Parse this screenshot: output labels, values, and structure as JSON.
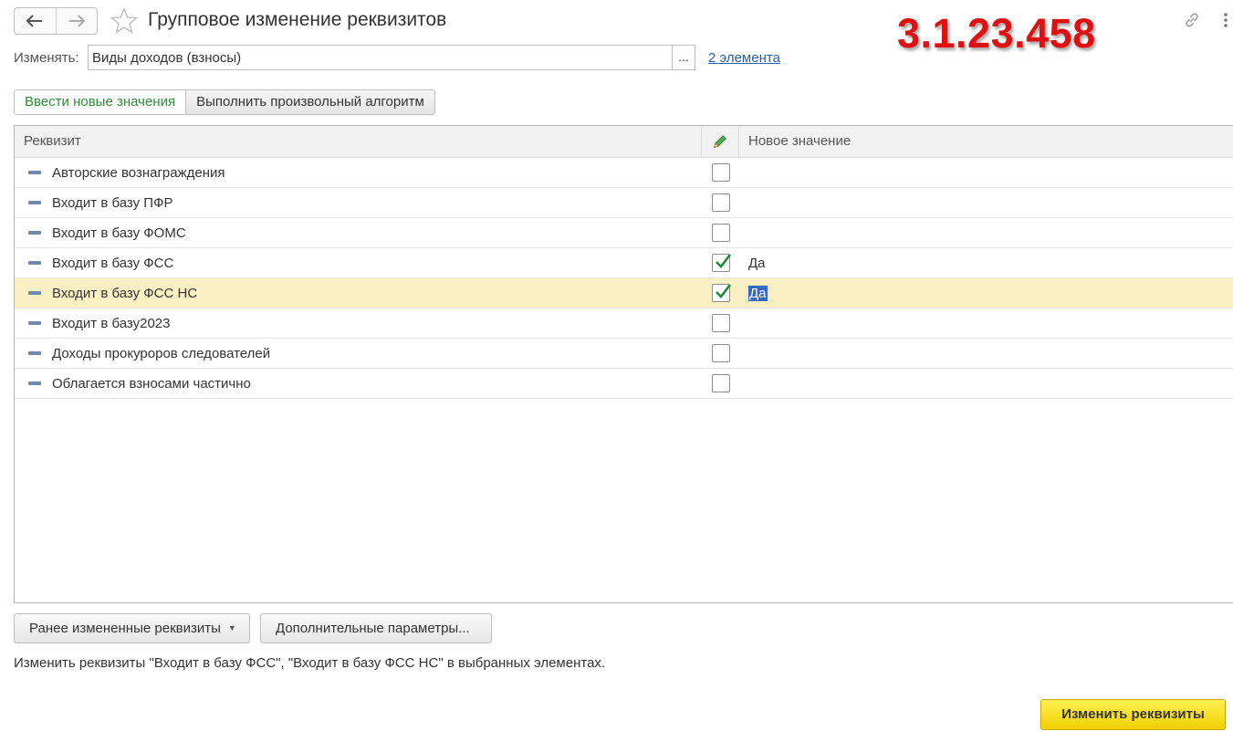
{
  "header": {
    "title": "Групповое изменение реквизитов",
    "version": "3.1.23.458"
  },
  "change": {
    "label": "Изменять:",
    "value": "Виды доходов (взносы)",
    "pick_label": "...",
    "elements_link": "2 элемента"
  },
  "tabs": [
    {
      "label": "Ввести новые значения",
      "active": true
    },
    {
      "label": "Выполнить произвольный алгоритм",
      "active": false
    }
  ],
  "table": {
    "columns": {
      "req": "Реквизит",
      "val": "Новое значение"
    },
    "rows": [
      {
        "name": "Авторские вознаграждения",
        "checked": false,
        "value": ""
      },
      {
        "name": "Входит в базу ПФР",
        "checked": false,
        "value": ""
      },
      {
        "name": "Входит в базу ФОМС",
        "checked": false,
        "value": ""
      },
      {
        "name": "Входит в базу ФСС",
        "checked": true,
        "value": "Да"
      },
      {
        "name": "Входит в базу ФСС НС",
        "checked": true,
        "value": "Да",
        "selected": true
      },
      {
        "name": "Входит в базу2023",
        "checked": false,
        "value": ""
      },
      {
        "name": "Доходы прокуроров следователей",
        "checked": false,
        "value": ""
      },
      {
        "name": "Облагается взносами частично",
        "checked": false,
        "value": ""
      }
    ]
  },
  "buttons": {
    "previous": "Ранее измененные реквизиты",
    "extra": "Дополнительные параметры...",
    "apply": "Изменить реквизиты"
  },
  "status_text": "Изменить реквизиты \"Входит в базу ФСС\", \"Входит в базу ФСС НС\" в выбранных элементах.",
  "colors": {
    "accent_green": "#2e8b3c",
    "version_red": "#e01010",
    "selected_row": "#fbf0c4",
    "primary_button": "#f1cf00",
    "link_blue": "#2a5ea8"
  }
}
